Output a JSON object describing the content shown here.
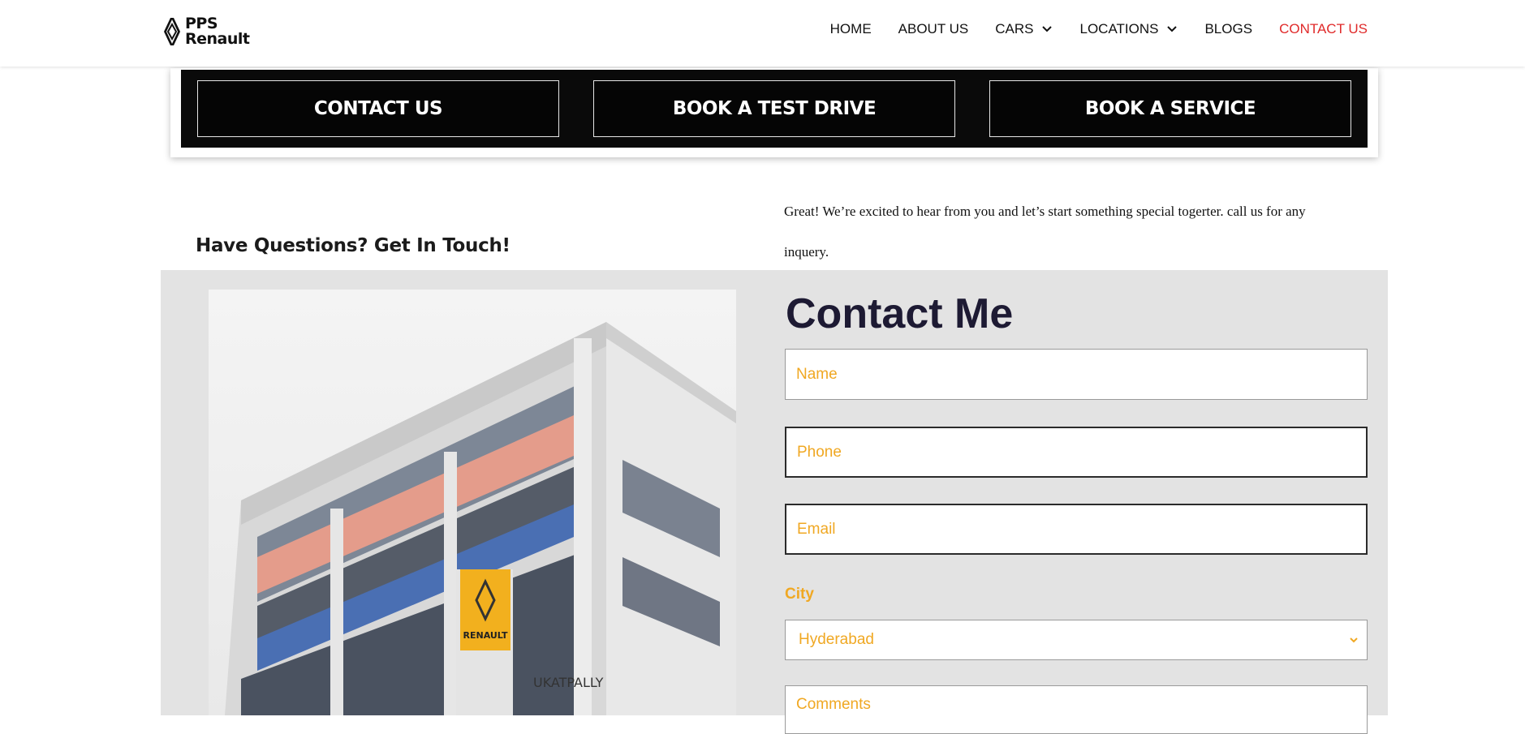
{
  "header": {
    "logo_line1": "PPS",
    "logo_line2": "Renault",
    "nav": [
      {
        "label": "HOME",
        "dropdown": false
      },
      {
        "label": "ABOUT US",
        "dropdown": false
      },
      {
        "label": "CARS",
        "dropdown": true
      },
      {
        "label": "LOCATIONS",
        "dropdown": true
      },
      {
        "label": "BLOGS",
        "dropdown": false
      },
      {
        "label": "CONTACT US",
        "dropdown": false,
        "active": true
      }
    ]
  },
  "cta": {
    "contact_label": "CONTACT US",
    "test_drive_label": "BOOK A TEST DRIVE",
    "service_label": "BOOK A SERVICE"
  },
  "intro": {
    "heading": "Have Questions? Get In Touch!",
    "text": "Great! We’re excited to hear from you and let’s start something special togerter. call us for any inquery."
  },
  "photo": {
    "sign_text": "UKATPALLY",
    "brand_text": "RENAULT"
  },
  "form": {
    "title": "Contact Me",
    "name_placeholder": "Name",
    "phone_placeholder": "Phone",
    "email_placeholder": "Email",
    "city_label": "City",
    "city_selected": "Hyderabad",
    "comments_placeholder": "Comments"
  },
  "colors": {
    "accent": "#f0a823",
    "nav_active": "#e02a2a",
    "band": "#0a0a0a",
    "section_bg": "#e3e3e3",
    "title": "#1d1a33"
  }
}
